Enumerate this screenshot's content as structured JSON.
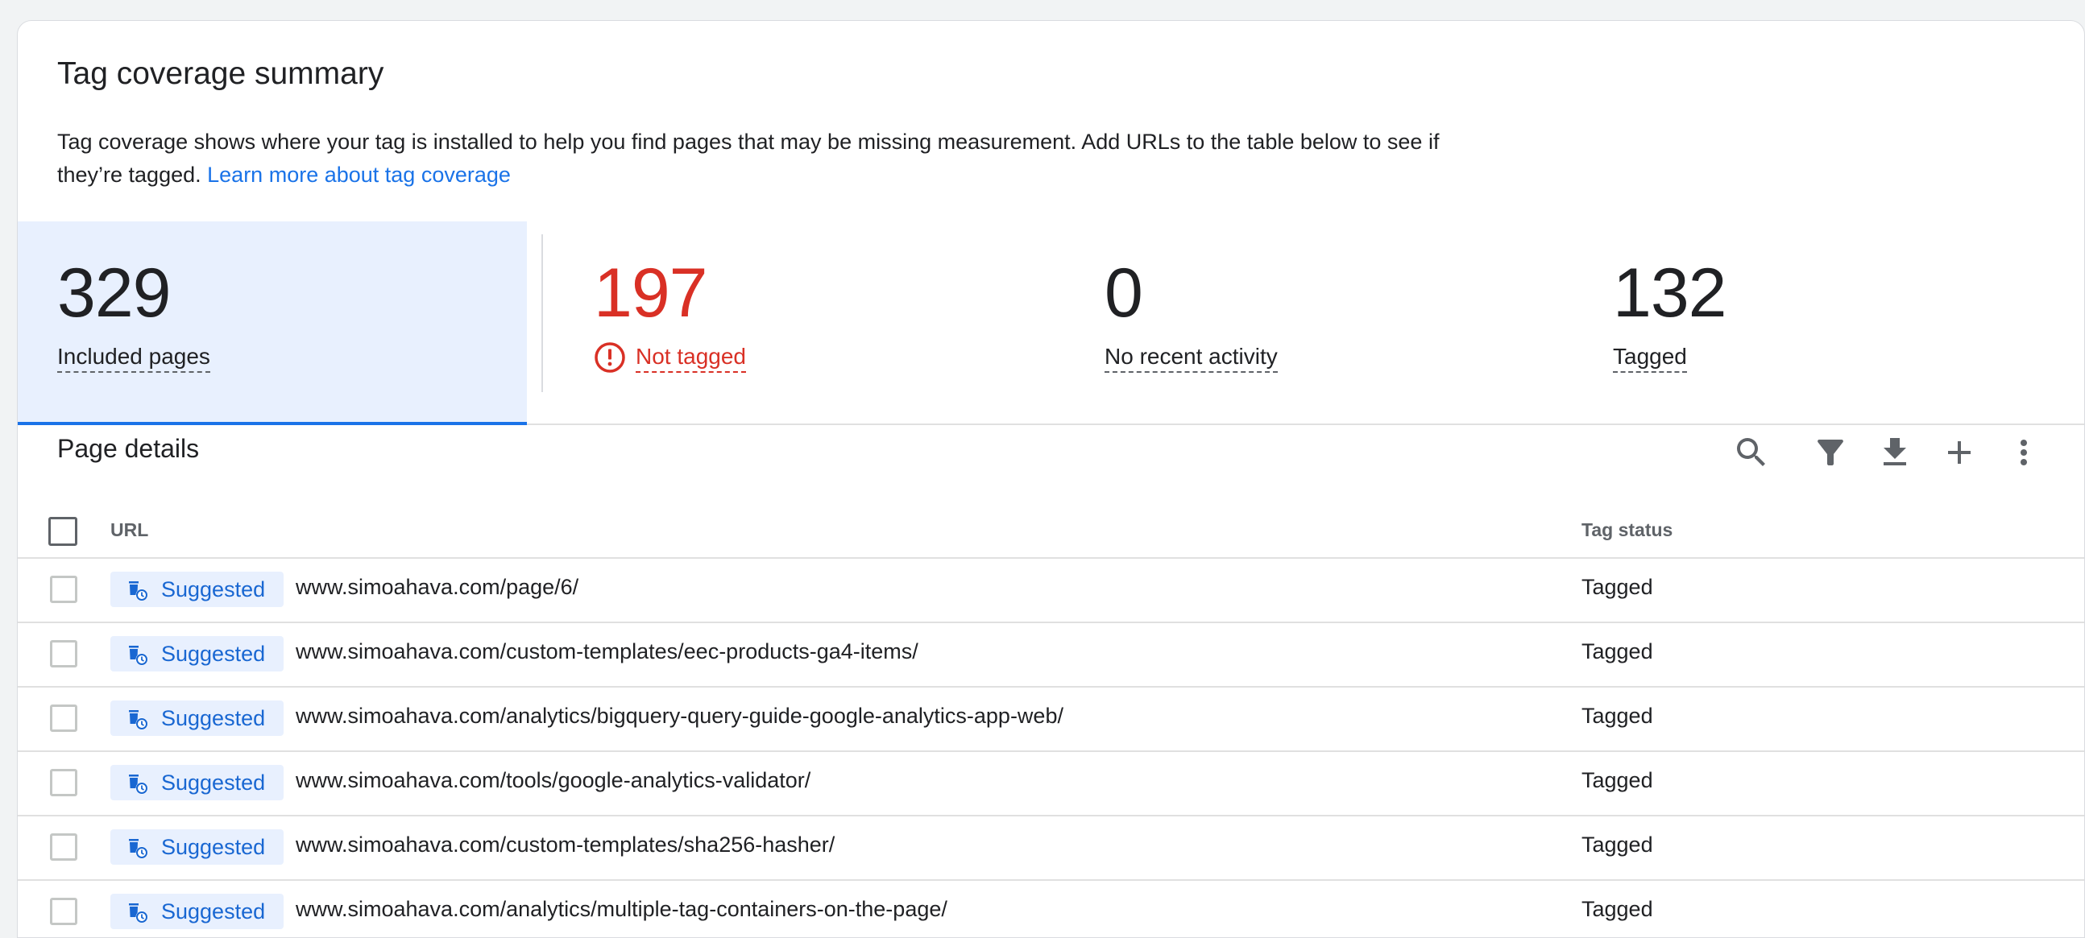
{
  "summary": {
    "title": "Tag coverage summary",
    "description": "Tag coverage shows where your tag is installed to help you find pages that may be missing measurement. Add URLs to the table below to see if they’re tagged.",
    "learn_more": "Learn more about tag coverage"
  },
  "stats": [
    {
      "value": "329",
      "label": "Included pages",
      "selected": true
    },
    {
      "value": "197",
      "label": "Not tagged",
      "status": "error"
    },
    {
      "value": "0",
      "label": "No recent activity"
    },
    {
      "value": "132",
      "label": "Tagged"
    }
  ],
  "details": {
    "title": "Page details",
    "toolbar": [
      "search-icon",
      "filter-icon",
      "download-icon",
      "add-icon",
      "more-vert-icon"
    ],
    "columns": {
      "url": "URL",
      "status": "Tag status"
    },
    "rows": [
      {
        "chip": "Suggested",
        "url": "www.simoahava.com/page/6/",
        "status": "Tagged"
      },
      {
        "chip": "Suggested",
        "url": "www.simoahava.com/custom-templates/eec-products-ga4-items/",
        "status": "Tagged"
      },
      {
        "chip": "Suggested",
        "url": "www.simoahava.com/analytics/bigquery-query-guide-google-analytics-app-web/",
        "status": "Tagged"
      },
      {
        "chip": "Suggested",
        "url": "www.simoahava.com/tools/google-analytics-validator/",
        "status": "Tagged"
      },
      {
        "chip": "Suggested",
        "url": "www.simoahava.com/custom-templates/sha256-hasher/",
        "status": "Tagged"
      },
      {
        "chip": "Suggested",
        "url": "www.simoahava.com/analytics/multiple-tag-containers-on-the-page/",
        "status": "Tagged"
      }
    ]
  },
  "colors": {
    "accent": "#1a73e8",
    "error": "#d93025",
    "selected_bg": "#e8f0fe",
    "chip_text": "#1967d2"
  }
}
